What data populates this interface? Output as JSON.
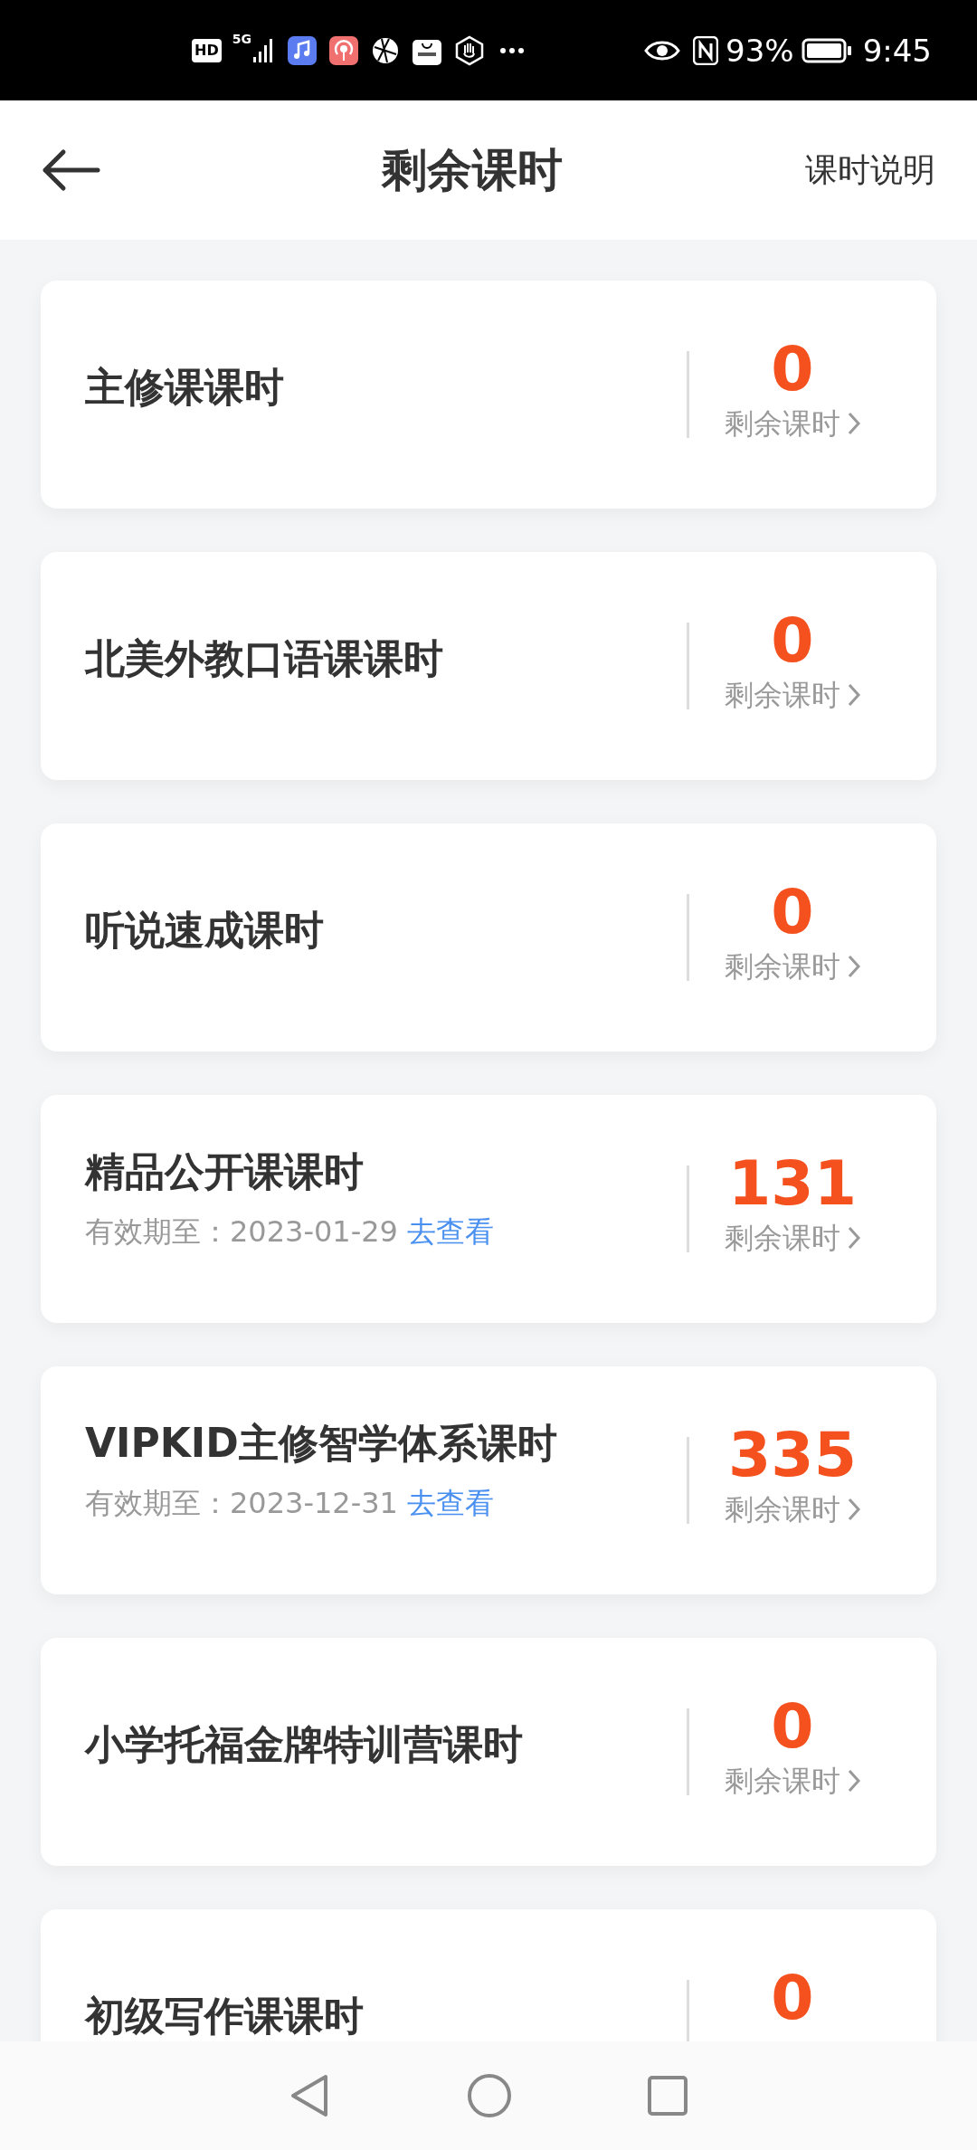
{
  "status_bar": {
    "hd": "HD",
    "network": "5G",
    "battery": "93%",
    "time": "9:45"
  },
  "header": {
    "title": "剩余课时",
    "action": "课时说明"
  },
  "cards": [
    {
      "title": "主修课课时",
      "count": "0",
      "label": "剩余课时"
    },
    {
      "title": "北美外教口语课课时",
      "count": "0",
      "label": "剩余课时"
    },
    {
      "title": "听说速成课时",
      "count": "0",
      "label": "剩余课时"
    },
    {
      "title": "精品公开课课时",
      "expiry": "有效期至：2023-01-29",
      "link": "去查看",
      "count": "131",
      "label": "剩余课时"
    },
    {
      "title": "VIPKID主修智学体系课时",
      "expiry": "有效期至：2023-12-31",
      "link": "去查看",
      "count": "335",
      "label": "剩余课时"
    },
    {
      "title": "小学托福金牌特训营课时",
      "count": "0",
      "label": "剩余课时"
    },
    {
      "title": "初级写作课课时",
      "count": "0"
    }
  ]
}
